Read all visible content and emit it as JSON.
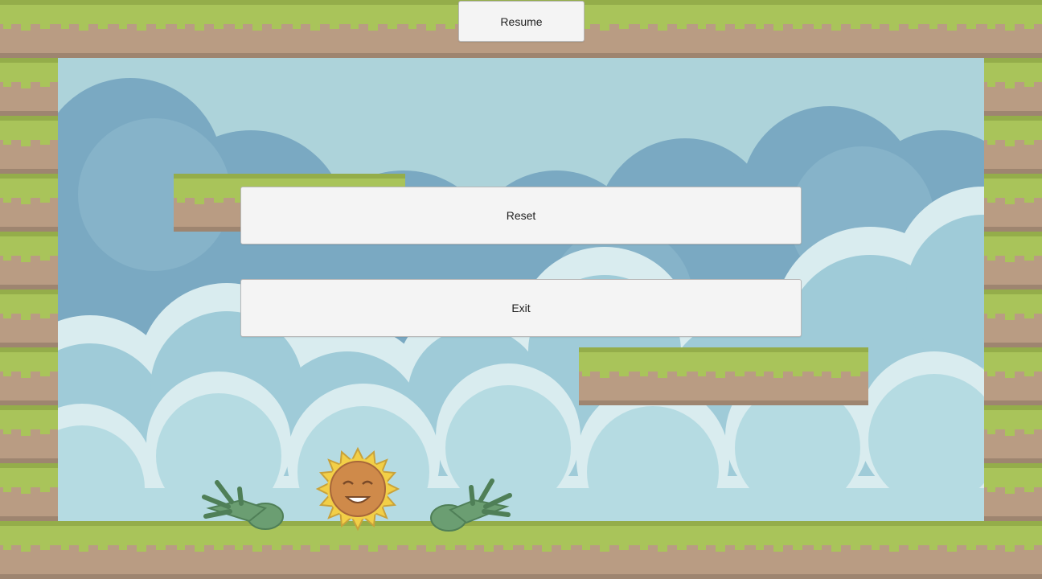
{
  "menu": {
    "resume_label": "Resume",
    "reset_label": "Reset",
    "exit_label": "Exit"
  },
  "colors": {
    "sky": "#add3da",
    "cloud_dark": "#7aa9c2",
    "cloud_mid": "#8fbad0",
    "cloud_light": "#d9ecef",
    "grass": "#a9c45a",
    "grass_dark": "#94ad4a",
    "dirt": "#b99c83",
    "dirt_dark": "#9e8570",
    "button_bg": "#f4f4f4"
  },
  "icons": {
    "character": "sunflower-icon",
    "hands": "green-glove-icon"
  }
}
